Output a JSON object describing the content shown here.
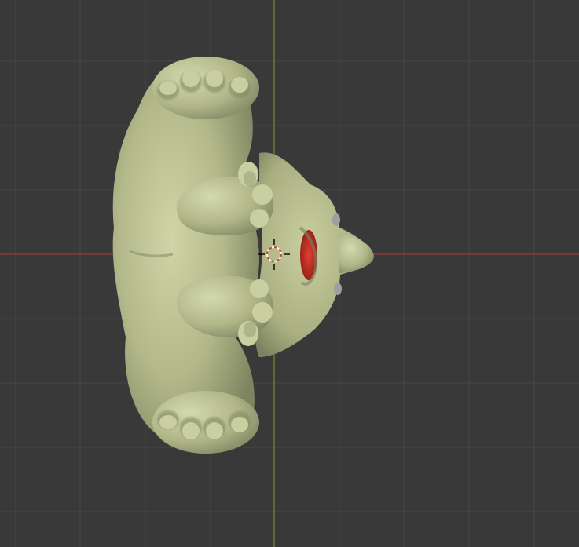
{
  "viewport": {
    "view": "top-orthographic",
    "background_color": "#393939",
    "grid_color": "#464646",
    "x_axis_color": "#9a3a3a",
    "y_axis_color": "#6b8a2a",
    "object_base_color": "#b3b98a",
    "object_highlight_color": "#cfd5a6",
    "object_shadow_color": "#7d8460",
    "mouth_color": "#c22d1f"
  },
  "scene": {
    "object": "sculpted-creature-mesh",
    "cursor": "3d-cursor-icon"
  }
}
